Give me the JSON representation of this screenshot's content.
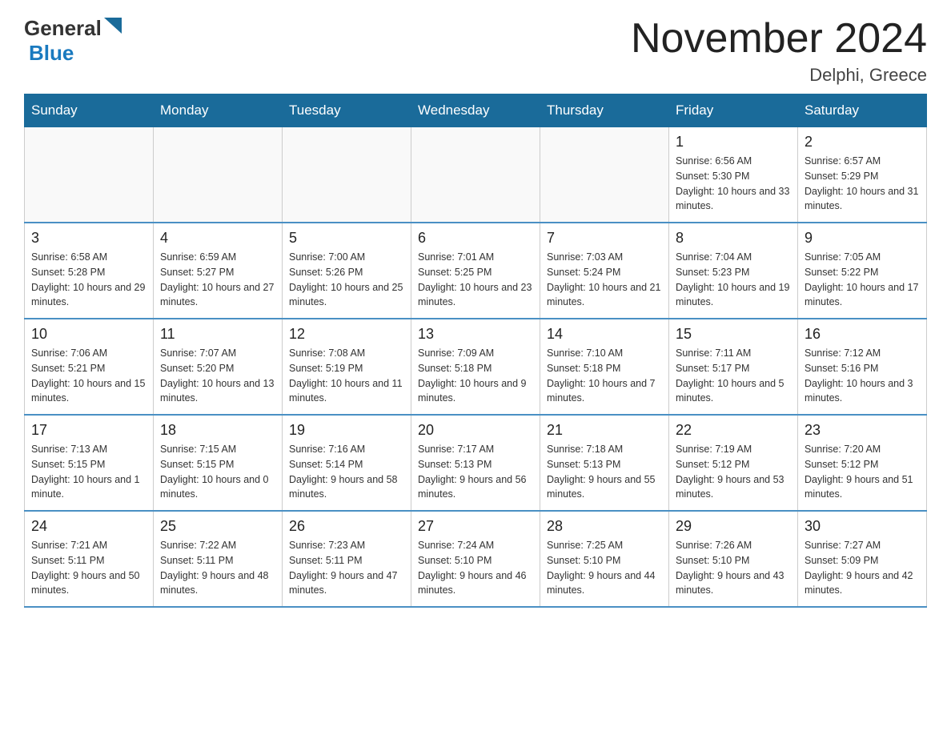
{
  "logo": {
    "text_general": "General",
    "text_blue": "Blue"
  },
  "title": "November 2024",
  "location": "Delphi, Greece",
  "days_of_week": [
    "Sunday",
    "Monday",
    "Tuesday",
    "Wednesday",
    "Thursday",
    "Friday",
    "Saturday"
  ],
  "weeks": [
    [
      {
        "day": "",
        "info": ""
      },
      {
        "day": "",
        "info": ""
      },
      {
        "day": "",
        "info": ""
      },
      {
        "day": "",
        "info": ""
      },
      {
        "day": "",
        "info": ""
      },
      {
        "day": "1",
        "info": "Sunrise: 6:56 AM\nSunset: 5:30 PM\nDaylight: 10 hours and 33 minutes."
      },
      {
        "day": "2",
        "info": "Sunrise: 6:57 AM\nSunset: 5:29 PM\nDaylight: 10 hours and 31 minutes."
      }
    ],
    [
      {
        "day": "3",
        "info": "Sunrise: 6:58 AM\nSunset: 5:28 PM\nDaylight: 10 hours and 29 minutes."
      },
      {
        "day": "4",
        "info": "Sunrise: 6:59 AM\nSunset: 5:27 PM\nDaylight: 10 hours and 27 minutes."
      },
      {
        "day": "5",
        "info": "Sunrise: 7:00 AM\nSunset: 5:26 PM\nDaylight: 10 hours and 25 minutes."
      },
      {
        "day": "6",
        "info": "Sunrise: 7:01 AM\nSunset: 5:25 PM\nDaylight: 10 hours and 23 minutes."
      },
      {
        "day": "7",
        "info": "Sunrise: 7:03 AM\nSunset: 5:24 PM\nDaylight: 10 hours and 21 minutes."
      },
      {
        "day": "8",
        "info": "Sunrise: 7:04 AM\nSunset: 5:23 PM\nDaylight: 10 hours and 19 minutes."
      },
      {
        "day": "9",
        "info": "Sunrise: 7:05 AM\nSunset: 5:22 PM\nDaylight: 10 hours and 17 minutes."
      }
    ],
    [
      {
        "day": "10",
        "info": "Sunrise: 7:06 AM\nSunset: 5:21 PM\nDaylight: 10 hours and 15 minutes."
      },
      {
        "day": "11",
        "info": "Sunrise: 7:07 AM\nSunset: 5:20 PM\nDaylight: 10 hours and 13 minutes."
      },
      {
        "day": "12",
        "info": "Sunrise: 7:08 AM\nSunset: 5:19 PM\nDaylight: 10 hours and 11 minutes."
      },
      {
        "day": "13",
        "info": "Sunrise: 7:09 AM\nSunset: 5:18 PM\nDaylight: 10 hours and 9 minutes."
      },
      {
        "day": "14",
        "info": "Sunrise: 7:10 AM\nSunset: 5:18 PM\nDaylight: 10 hours and 7 minutes."
      },
      {
        "day": "15",
        "info": "Sunrise: 7:11 AM\nSunset: 5:17 PM\nDaylight: 10 hours and 5 minutes."
      },
      {
        "day": "16",
        "info": "Sunrise: 7:12 AM\nSunset: 5:16 PM\nDaylight: 10 hours and 3 minutes."
      }
    ],
    [
      {
        "day": "17",
        "info": "Sunrise: 7:13 AM\nSunset: 5:15 PM\nDaylight: 10 hours and 1 minute."
      },
      {
        "day": "18",
        "info": "Sunrise: 7:15 AM\nSunset: 5:15 PM\nDaylight: 10 hours and 0 minutes."
      },
      {
        "day": "19",
        "info": "Sunrise: 7:16 AM\nSunset: 5:14 PM\nDaylight: 9 hours and 58 minutes."
      },
      {
        "day": "20",
        "info": "Sunrise: 7:17 AM\nSunset: 5:13 PM\nDaylight: 9 hours and 56 minutes."
      },
      {
        "day": "21",
        "info": "Sunrise: 7:18 AM\nSunset: 5:13 PM\nDaylight: 9 hours and 55 minutes."
      },
      {
        "day": "22",
        "info": "Sunrise: 7:19 AM\nSunset: 5:12 PM\nDaylight: 9 hours and 53 minutes."
      },
      {
        "day": "23",
        "info": "Sunrise: 7:20 AM\nSunset: 5:12 PM\nDaylight: 9 hours and 51 minutes."
      }
    ],
    [
      {
        "day": "24",
        "info": "Sunrise: 7:21 AM\nSunset: 5:11 PM\nDaylight: 9 hours and 50 minutes."
      },
      {
        "day": "25",
        "info": "Sunrise: 7:22 AM\nSunset: 5:11 PM\nDaylight: 9 hours and 48 minutes."
      },
      {
        "day": "26",
        "info": "Sunrise: 7:23 AM\nSunset: 5:11 PM\nDaylight: 9 hours and 47 minutes."
      },
      {
        "day": "27",
        "info": "Sunrise: 7:24 AM\nSunset: 5:10 PM\nDaylight: 9 hours and 46 minutes."
      },
      {
        "day": "28",
        "info": "Sunrise: 7:25 AM\nSunset: 5:10 PM\nDaylight: 9 hours and 44 minutes."
      },
      {
        "day": "29",
        "info": "Sunrise: 7:26 AM\nSunset: 5:10 PM\nDaylight: 9 hours and 43 minutes."
      },
      {
        "day": "30",
        "info": "Sunrise: 7:27 AM\nSunset: 5:09 PM\nDaylight: 9 hours and 42 minutes."
      }
    ]
  ]
}
